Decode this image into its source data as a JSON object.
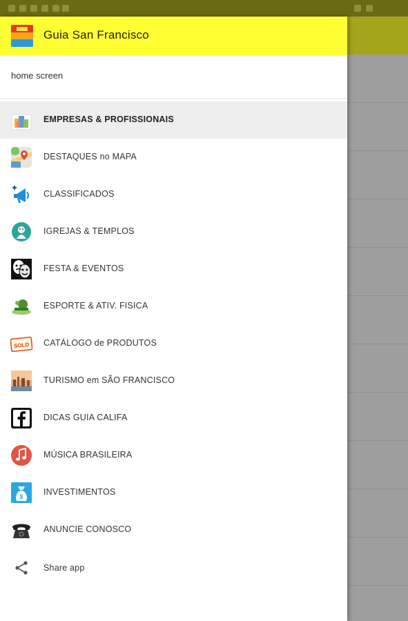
{
  "app": {
    "title": "Guia San Francisco"
  },
  "drawer": {
    "home_label": "home screen",
    "items": [
      {
        "label": "EMPRESAS & PROFISSIONAIS",
        "icon": "buildings-icon",
        "active": true
      },
      {
        "label": "DESTAQUES no MAPA",
        "icon": "map-icon"
      },
      {
        "label": "CLASSIFICADOS",
        "icon": "megaphone-icon"
      },
      {
        "label": "IGREJAS & TEMPLOS",
        "icon": "church-icon"
      },
      {
        "label": "FESTA & EVENTOS",
        "icon": "theater-masks-icon"
      },
      {
        "label": "ESPORTE & ATIV. FISICA",
        "icon": "sport-icon"
      },
      {
        "label": "CATÁLOGO de PRODUTOS",
        "icon": "sold-tag-icon"
      },
      {
        "label": "TURISMO em SÃO FRANCISCO",
        "icon": "city-photo-icon"
      },
      {
        "label": "DICAS GUIA CALIFA",
        "icon": "facebook-icon"
      },
      {
        "label": "MÚSICA BRASILEIRA",
        "icon": "music-note-icon"
      },
      {
        "label": "INVESTIMENTOS",
        "icon": "money-bag-icon"
      },
      {
        "label": "ANUNCIE CONOSCO",
        "icon": "telephone-icon"
      },
      {
        "label": "Share app",
        "icon": "share-icon"
      }
    ]
  },
  "colors": {
    "header": "#ffff33",
    "statusbar": "#6b6a14",
    "scrim": "#9e9e9e"
  }
}
